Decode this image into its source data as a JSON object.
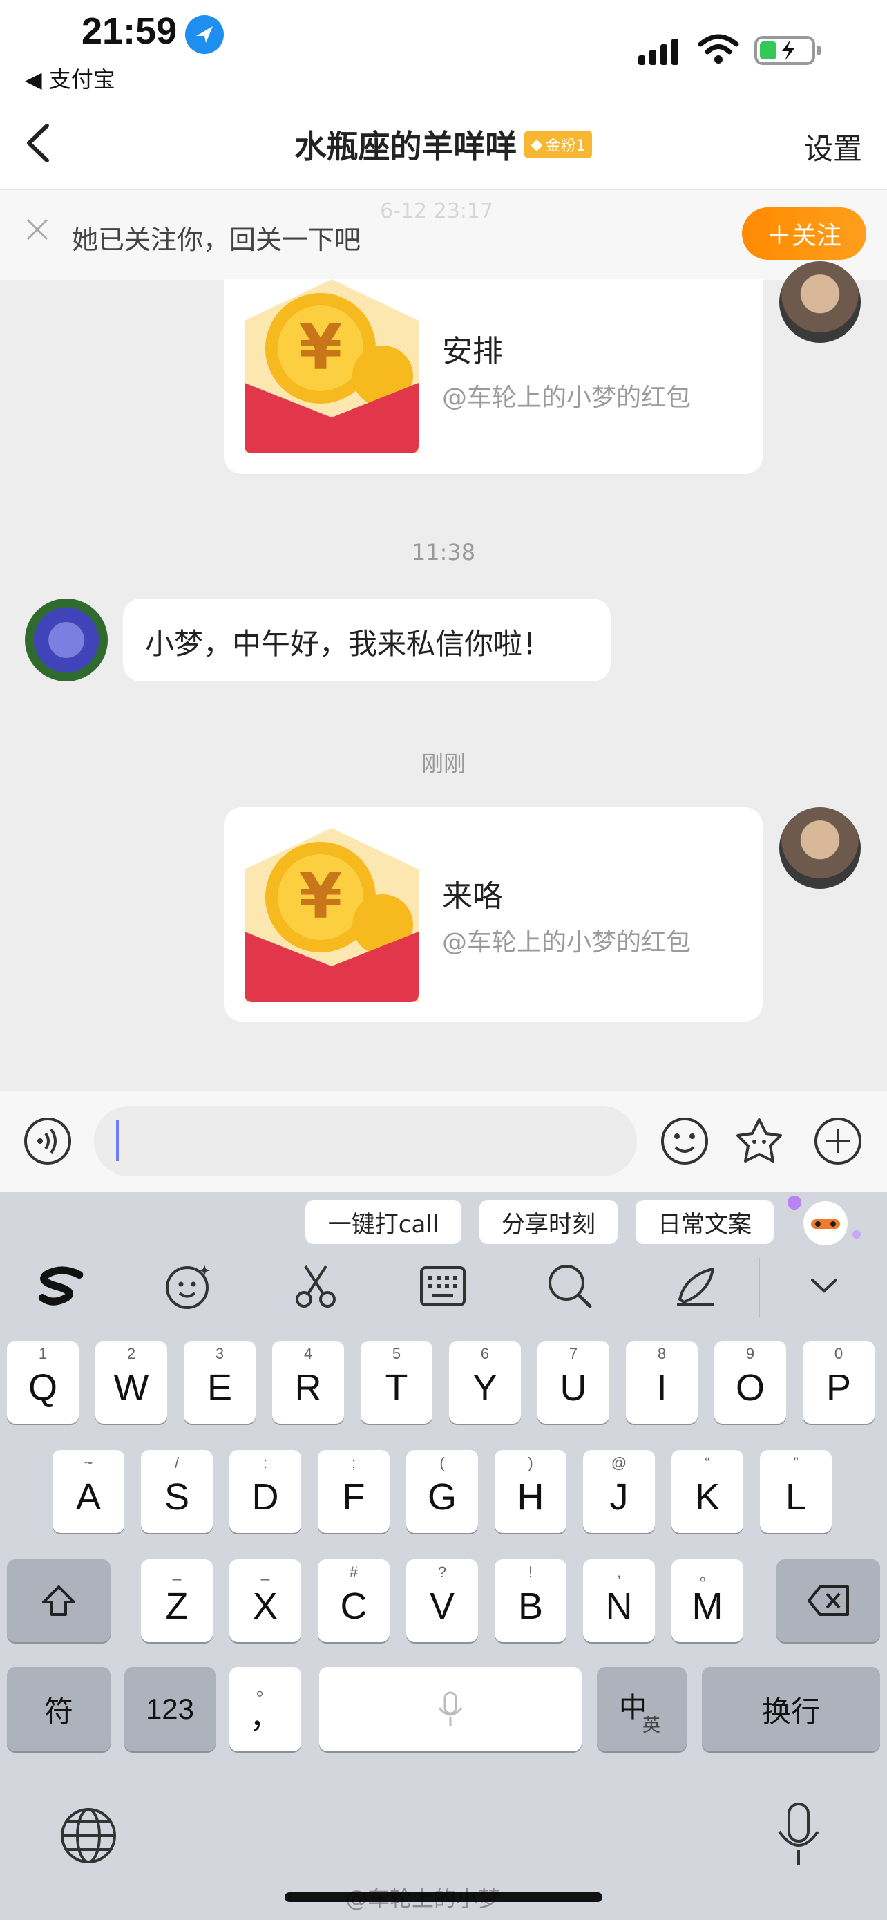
{
  "status_bar": {
    "time": "21:59",
    "back_app": "◀ 支付宝"
  },
  "nav": {
    "title": "水瓶座的羊咩咩",
    "fan_badge": "金粉1",
    "settings": "设置"
  },
  "follow_banner": {
    "text": "她已关注你，回关一下吧",
    "button": "＋关注",
    "ghost_time": "6-12 23:17"
  },
  "messages": [
    {
      "type": "red_packet",
      "side": "right",
      "title": "安排",
      "subtitle": "@车轮上的小梦的红包"
    },
    {
      "type": "timestamp",
      "text": "11:38"
    },
    {
      "type": "text",
      "side": "left",
      "text": "小梦，中午好，我来私信你啦！"
    },
    {
      "type": "timestamp",
      "text": "刚刚"
    },
    {
      "type": "red_packet",
      "side": "right",
      "title": "来咯",
      "subtitle": "@车轮上的小梦的红包"
    }
  ],
  "input": {
    "placeholder": ""
  },
  "suggestions": [
    "一键打call",
    "分享时刻",
    "日常文案"
  ],
  "keyboard": {
    "row1": [
      {
        "main": "Q",
        "sub": "1"
      },
      {
        "main": "W",
        "sub": "2"
      },
      {
        "main": "E",
        "sub": "3"
      },
      {
        "main": "R",
        "sub": "4"
      },
      {
        "main": "T",
        "sub": "5"
      },
      {
        "main": "Y",
        "sub": "6"
      },
      {
        "main": "U",
        "sub": "7"
      },
      {
        "main": "I",
        "sub": "8"
      },
      {
        "main": "O",
        "sub": "9"
      },
      {
        "main": "P",
        "sub": "0"
      }
    ],
    "row2": [
      {
        "main": "A",
        "sub": "~"
      },
      {
        "main": "S",
        "sub": "/"
      },
      {
        "main": "D",
        "sub": ":"
      },
      {
        "main": "F",
        "sub": ";"
      },
      {
        "main": "G",
        "sub": "("
      },
      {
        "main": "H",
        "sub": ")"
      },
      {
        "main": "J",
        "sub": "@"
      },
      {
        "main": "K",
        "sub": "“"
      },
      {
        "main": "L",
        "sub": "”"
      }
    ],
    "row3": [
      {
        "main": "Z",
        "sub": "_"
      },
      {
        "main": "X",
        "sub": "_"
      },
      {
        "main": "C",
        "sub": "#"
      },
      {
        "main": "V",
        "sub": "?"
      },
      {
        "main": "B",
        "sub": "!"
      },
      {
        "main": "N",
        "sub": ","
      },
      {
        "main": "M",
        "sub": "。"
      }
    ],
    "symbols_key": "符",
    "numbers_key": "123",
    "punct_key": "，",
    "punct_key_sub": "。",
    "lang_key_main": "中",
    "lang_key_sub": "英",
    "return_key": "换行"
  },
  "watermark": "@车轮上的小梦",
  "colors": {
    "accent_orange": "#ff8a00",
    "bubble_bg": "#ffffff",
    "chat_bg": "#ededed",
    "keyboard_bg": "#d3d6dd"
  }
}
